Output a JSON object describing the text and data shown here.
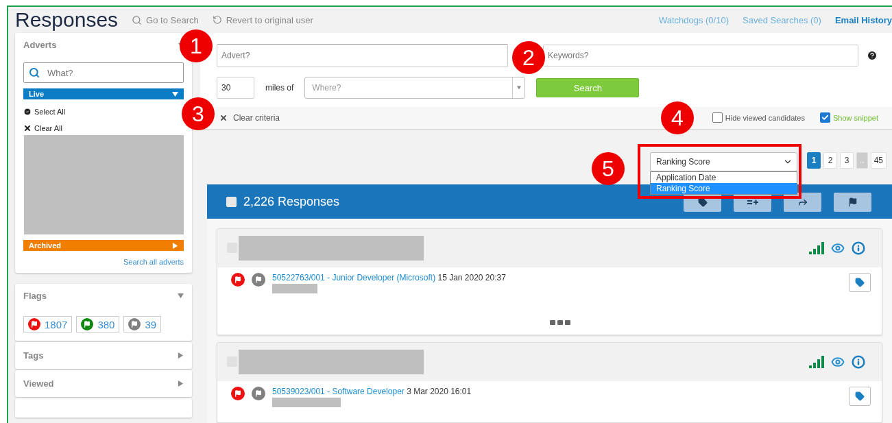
{
  "page_title": "Responses",
  "header_actions": [
    {
      "kind": "search",
      "label": "Go to Search"
    },
    {
      "kind": "revert",
      "label": "Revert to original user"
    }
  ],
  "top_links": [
    {
      "label": "Watchdogs (0/10)",
      "emphasis": false
    },
    {
      "label": "Saved Searches (0)",
      "emphasis": false
    },
    {
      "label": "Email History",
      "emphasis": true
    }
  ],
  "sidebar": {
    "adverts": {
      "title": "Adverts",
      "search_placeholder": "What?",
      "live": "Live",
      "select_all": "Select All",
      "clear_all": "Clear All",
      "archived": "Archived",
      "search_all": "Search all adverts"
    },
    "flags": {
      "title": "Flags",
      "expanded": true,
      "items": [
        {
          "color": "#ee1111",
          "count": "1807"
        },
        {
          "color": "#118811",
          "count": "380"
        },
        {
          "color": "#808080",
          "count": "39"
        }
      ]
    },
    "sections": [
      {
        "title": "Tags",
        "expanded": false
      },
      {
        "title": "Viewed",
        "expanded": false
      }
    ]
  },
  "search": {
    "advert_placeholder": "Advert?",
    "keywords_placeholder": "Keywords?",
    "miles": "30",
    "miles_label": "miles of",
    "where_placeholder": "Where?",
    "button": "Search",
    "clear": "Clear criteria",
    "options": [
      {
        "label": "Hide viewed candidates",
        "checked": false
      },
      {
        "label": "Show snippet",
        "checked": true
      }
    ]
  },
  "sort": {
    "value": "Ranking Score",
    "open": true,
    "options": [
      {
        "label": "Application Date",
        "selected": false
      },
      {
        "label": "Ranking Score",
        "selected": true
      }
    ]
  },
  "pagination": [
    {
      "kind": "page",
      "label": "1",
      "selected": true
    },
    {
      "kind": "page",
      "label": "2",
      "selected": false
    },
    {
      "kind": "page",
      "label": "3",
      "selected": false
    },
    {
      "kind": "ellipsis",
      "label": "..",
      "selected": false
    },
    {
      "kind": "page",
      "label": "45",
      "selected": false
    }
  ],
  "results": {
    "count": "2,226 Responses",
    "all_checked": false,
    "toolbar": [
      {
        "kind": "tag"
      },
      {
        "kind": "add-list"
      },
      {
        "kind": "forward"
      },
      {
        "kind": "flag"
      }
    ]
  },
  "responses": [
    {
      "link": "50522763/001 - Junior Developer (Microsoft)",
      "date": "15 Jan 2020 20:37",
      "flags": [
        {
          "color": "#ee1111"
        },
        {
          "color": "#808080"
        }
      ],
      "more": true,
      "checked": false
    },
    {
      "link": "50539023/001 - Software Developer",
      "date": "3 Mar 2020 16:01",
      "flags": [
        {
          "color": "#ee1111"
        },
        {
          "color": "#808080"
        }
      ],
      "more": false,
      "checked": false
    }
  ],
  "callouts": [
    {
      "label": "1"
    },
    {
      "label": "2"
    },
    {
      "label": "3"
    },
    {
      "label": "4"
    },
    {
      "label": "5"
    }
  ]
}
